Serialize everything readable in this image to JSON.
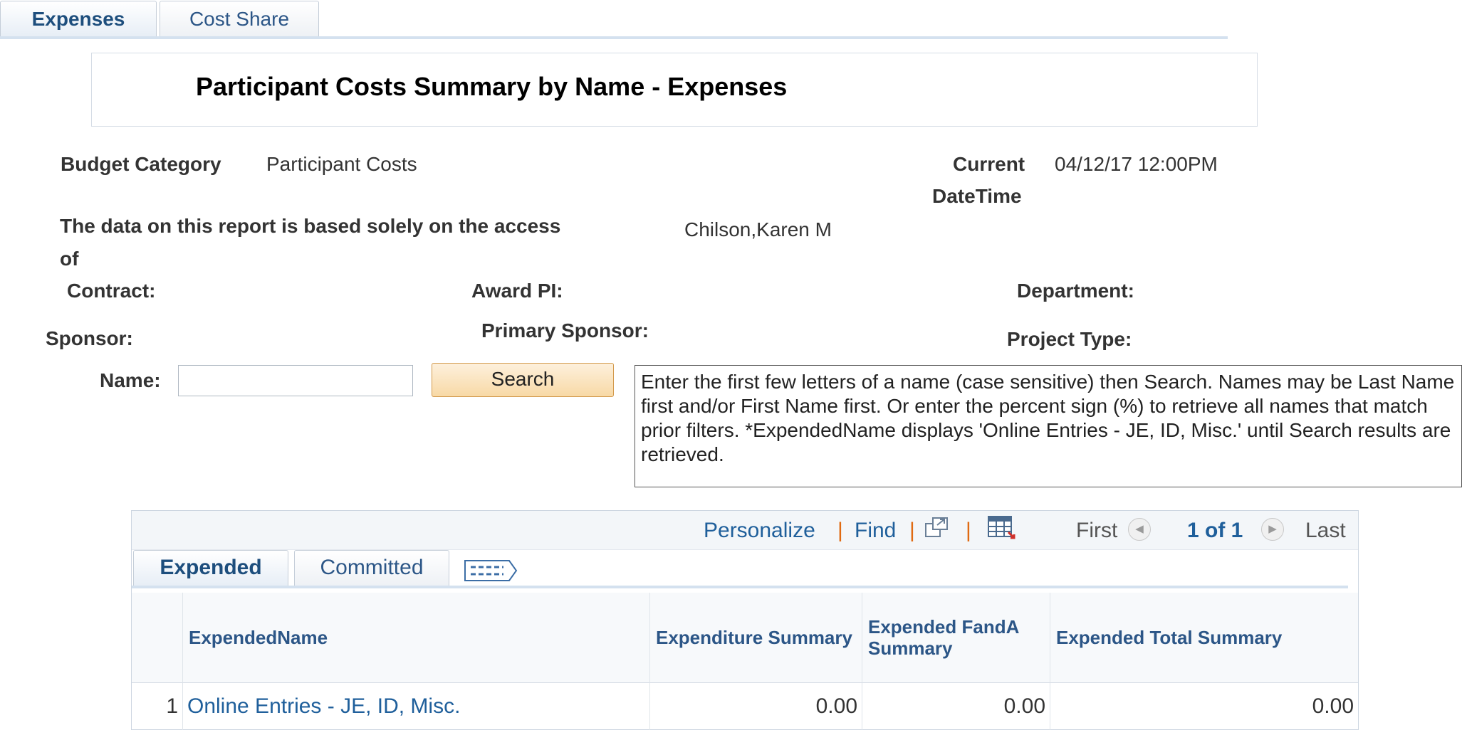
{
  "tabs": {
    "expenses": "Expenses",
    "cost_share": "Cost Share"
  },
  "title": "Participant Costs Summary by Name - Expenses",
  "header": {
    "budget_category_label": "Budget Category",
    "budget_category_value": "Participant Costs",
    "current_label_1": "Current",
    "current_label_2": "DateTime",
    "current_value": "04/12/17 12:00PM",
    "access_label_1": "The data on this report is based solely on the access",
    "access_label_2": "of",
    "access_value": "Chilson,Karen M",
    "contract_label": "Contract:",
    "award_pi_label": "Award PI:",
    "department_label": "Department:",
    "sponsor_label": "Sponsor:",
    "primary_sponsor_label": "Primary Sponsor:",
    "project_type_label": "Project Type:"
  },
  "search": {
    "name_label": "Name:",
    "name_value": "",
    "button": "Search",
    "help_text": "Enter the first few letters of a name (case sensitive) then Search. Names may be Last Name first and/or First Name first. Or enter the percent sign (%) to retrieve all names that match prior filters. *ExpendedName displays 'Online Entries - JE, ID, Misc.' until Search results are retrieved."
  },
  "grid": {
    "nav": {
      "personalize": "Personalize",
      "find": "Find",
      "sep": "|",
      "first": "First",
      "count": "1 of 1",
      "last": "Last"
    },
    "tabs": {
      "expended": "Expended",
      "committed": "Committed"
    },
    "columns": [
      "ExpendedName",
      "Expenditure Summary",
      "Expended FandA Summary",
      "Expended Total Summary"
    ],
    "rows": [
      {
        "num": "1",
        "name": "Online Entries - JE, ID, Misc.",
        "expenditure": "0.00",
        "fanda": "0.00",
        "total": "0.00"
      }
    ]
  },
  "colors": {
    "link": "#1f5f9b",
    "separator": "#e06a12",
    "button_bg": "#f8d9a6",
    "tab_line": "#d4e1ef"
  },
  "icons": [
    "new-window-icon",
    "download-grid-icon",
    "previous-arrow-icon",
    "next-arrow-icon",
    "show-all-columns-icon"
  ]
}
